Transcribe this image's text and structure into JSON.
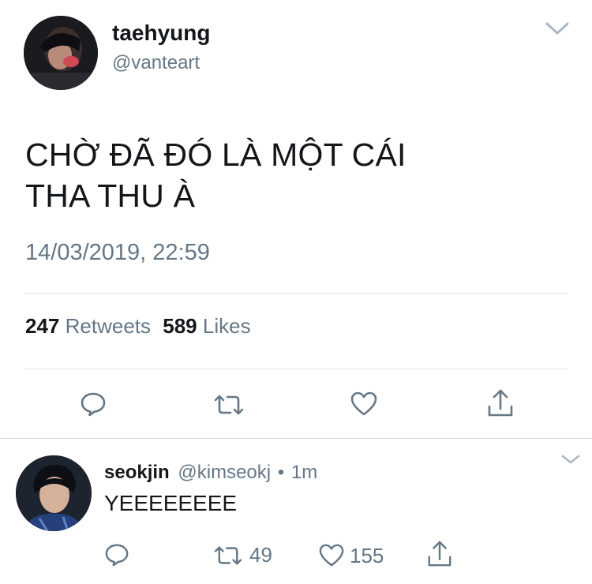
{
  "tweet": {
    "display_name": "taehyung",
    "handle": "@vanteart",
    "text_line1": "CHỜ ĐÃ ĐÓ LÀ MỘT CÁI",
    "text_line2": "THA THU À",
    "timestamp": "14/03/2019, 22:59",
    "retweets_count": "247",
    "retweets_label": "Retweets",
    "likes_count": "589",
    "likes_label": "Likes",
    "avatar_icon": "user-avatar-taehyung",
    "menu_icon": "chevron-down-icon"
  },
  "actions": {
    "reply_icon": "reply-icon",
    "retweet_icon": "retweet-icon",
    "like_icon": "heart-icon",
    "share_icon": "share-icon"
  },
  "reply": {
    "display_name": "seokjin",
    "handle": "@kimseokj",
    "separator": "•",
    "time": "1m",
    "text": "YEEEEEEEE",
    "retweet_count": "49",
    "like_count": "155",
    "avatar_icon": "user-avatar-seokjin",
    "menu_icon": "chevron-down-icon"
  },
  "colors": {
    "text": "#14171a",
    "muted": "#657786",
    "divider": "#dfe3e7"
  }
}
